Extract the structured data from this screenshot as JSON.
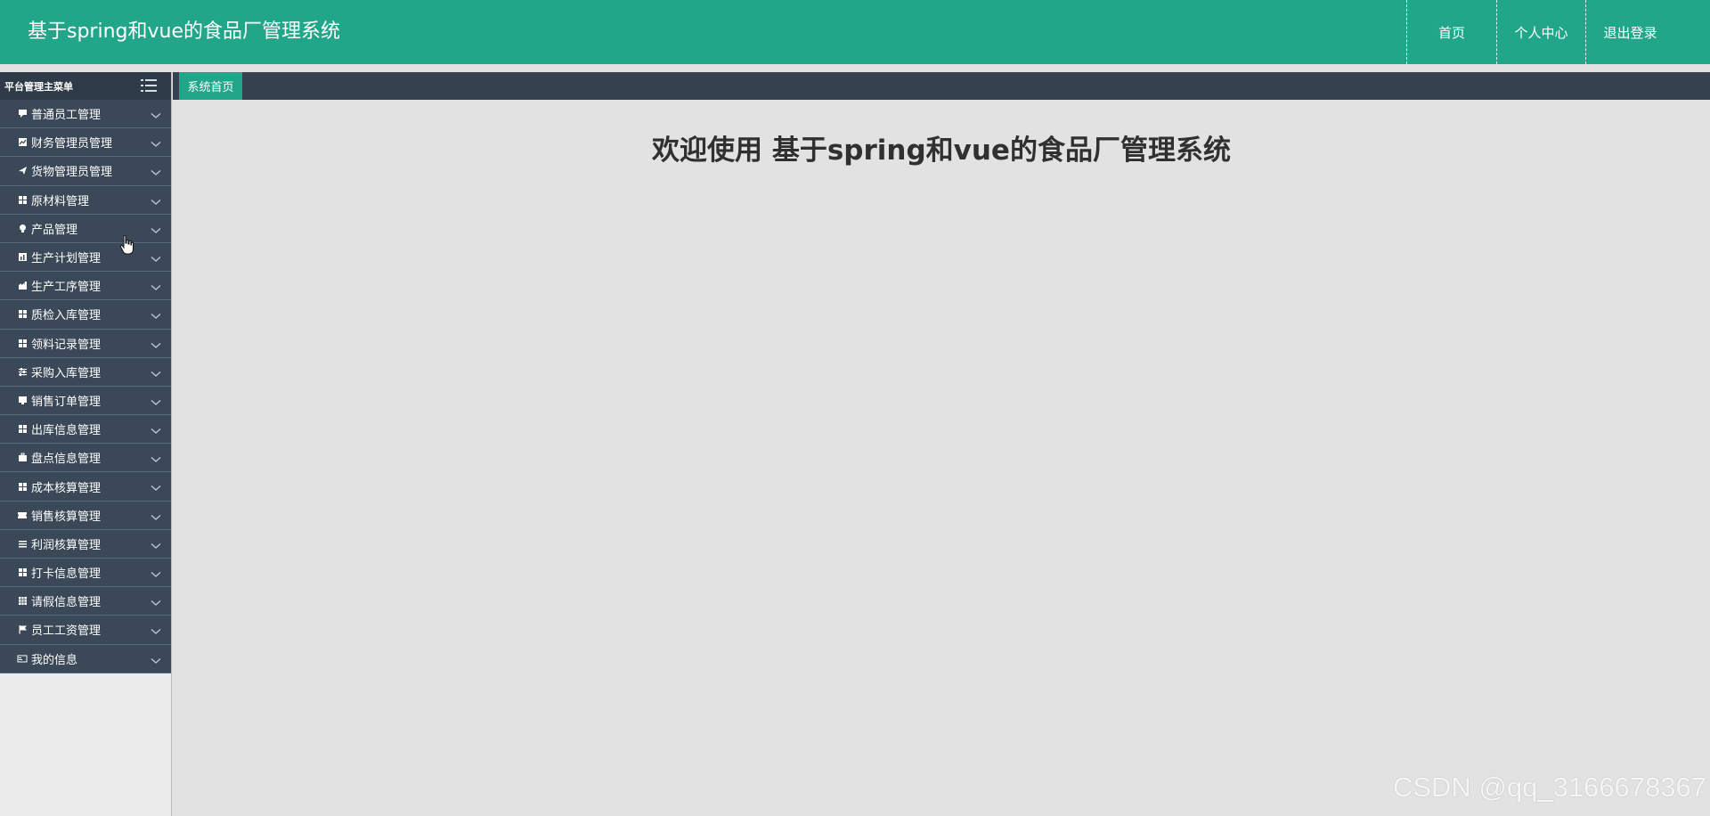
{
  "header": {
    "title": "基于spring和vue的食品厂管理系统",
    "nav": {
      "home": "首页",
      "profile": "个人中心",
      "logout": "退出登录"
    }
  },
  "sidebar": {
    "title": "平台管理主菜单",
    "items": [
      {
        "label": "普通员工管理",
        "icon": "comment-icon"
      },
      {
        "label": "财务管理员管理",
        "icon": "chart-icon"
      },
      {
        "label": "货物管理员管理",
        "icon": "send-icon"
      },
      {
        "label": "原材料管理",
        "icon": "grid-icon"
      },
      {
        "label": "产品管理",
        "icon": "bulb-icon"
      },
      {
        "label": "生产计划管理",
        "icon": "bar-chart-icon"
      },
      {
        "label": "生产工序管理",
        "icon": "factory-icon"
      },
      {
        "label": "质检入库管理",
        "icon": "grid-icon"
      },
      {
        "label": "领料记录管理",
        "icon": "grid-icon"
      },
      {
        "label": "采购入库管理",
        "icon": "sliders-icon"
      },
      {
        "label": "销售订单管理",
        "icon": "monitor-icon"
      },
      {
        "label": "出库信息管理",
        "icon": "grid-icon"
      },
      {
        "label": "盘点信息管理",
        "icon": "briefcase-icon"
      },
      {
        "label": "成本核算管理",
        "icon": "grid-icon"
      },
      {
        "label": "销售核算管理",
        "icon": "ticket-icon"
      },
      {
        "label": "利润核算管理",
        "icon": "list-icon"
      },
      {
        "label": "打卡信息管理",
        "icon": "grid-icon"
      },
      {
        "label": "请假信息管理",
        "icon": "table-icon"
      },
      {
        "label": "员工工资管理",
        "icon": "flag-icon"
      },
      {
        "label": "我的信息",
        "icon": "id-card-icon"
      }
    ]
  },
  "tabs": [
    {
      "label": "系统首页",
      "active": true
    }
  ],
  "main": {
    "welcome": "欢迎使用 基于spring和vue的食品厂管理系统"
  },
  "watermark": "CSDN @qq_3166678367",
  "colors": {
    "header": "#22a68a",
    "sidebar_item": "#3a4857",
    "sidebar_head": "#2e3a47",
    "tabbar": "#36424f",
    "content_bg": "#e2e2e2"
  }
}
